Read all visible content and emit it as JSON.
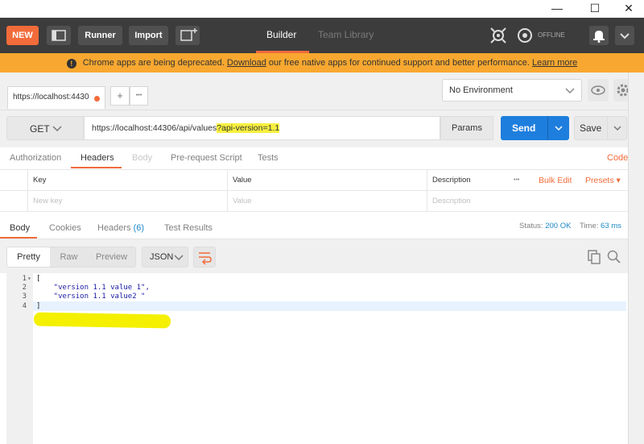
{
  "window": {
    "minimize": "—",
    "maximize": "☐",
    "close": "✕"
  },
  "header": {
    "new_label": "NEW",
    "runner_label": "Runner",
    "import_label": "Import",
    "tabs": [
      {
        "label": "Builder"
      },
      {
        "label": "Team Library"
      }
    ],
    "sync_status": "OFFLINE"
  },
  "banner": {
    "text_before": "Chrome apps are being deprecated. ",
    "download_link": "Download",
    "text_after": " our free native apps for continued support and better performance. ",
    "learn_more_link": "Learn more"
  },
  "request_tabs": [
    {
      "label": "https://localhost:4430"
    }
  ],
  "request_tab_controls": {
    "add": "+",
    "more": "•••"
  },
  "environment": {
    "selected": "No Environment"
  },
  "request": {
    "method": "GET",
    "url_plain": "https://localhost:44306/api/values",
    "url_query": "?api-version=1.1",
    "params_label": "Params",
    "send_label": "Send",
    "save_label": "Save"
  },
  "request_subtabs": [
    {
      "label": "Authorization"
    },
    {
      "label": "Headers"
    },
    {
      "label": "Body"
    },
    {
      "label": "Pre-request Script"
    },
    {
      "label": "Tests"
    }
  ],
  "code_link": "Code",
  "headers_table": {
    "columns": [
      "Key",
      "Value",
      "Description"
    ],
    "more": "•••",
    "bulk_edit": "Bulk Edit",
    "presets": "Presets ▾",
    "placeholders": {
      "key": "New key",
      "value": "Value",
      "description": "Description"
    }
  },
  "response": {
    "tabs": [
      {
        "label": "Body"
      },
      {
        "label": "Cookies"
      },
      {
        "label": "Headers",
        "count": "(6)"
      },
      {
        "label": "Test Results"
      }
    ],
    "status_label": "Status:",
    "status_value": "200 OK",
    "time_label": "Time:",
    "time_value": "63 ms",
    "view_modes": [
      "Pretty",
      "Raw",
      "Preview"
    ],
    "format": "JSON",
    "code_lines": [
      {
        "num": "1",
        "text": "["
      },
      {
        "num": "2",
        "text": "    \"version 1.1 value 1\","
      },
      {
        "num": "3",
        "text": "    \"version 1.1 value2 \""
      },
      {
        "num": "4",
        "text": "]"
      }
    ]
  },
  "colors": {
    "accent": "#f26b3a",
    "primary": "#1e7ede",
    "banner": "#f8a830",
    "highlight": "#f4f000"
  }
}
